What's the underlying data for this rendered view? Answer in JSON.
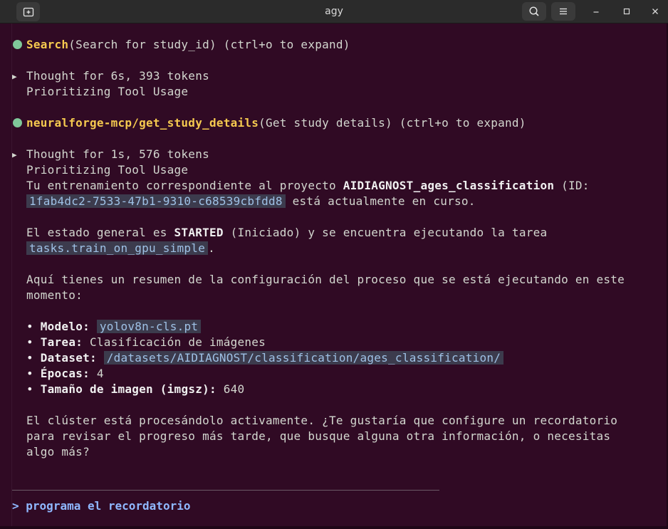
{
  "window": {
    "title": "agy",
    "icons": {
      "new_tab": "new-tab-icon",
      "search": "search-icon",
      "menu": "hamburger-menu-icon",
      "minimize": "minimize-icon",
      "maximize": "maximize-icon",
      "close": "close-icon"
    }
  },
  "colors": {
    "background": "#300a24",
    "tool_name": "#f5c94f",
    "status_dot": "#7fc89a",
    "code_text": "#9fc1e6",
    "prompt": "#8fb8ff"
  },
  "transcript": {
    "tool1": {
      "name": "Search",
      "args": "(Search for study_id) (ctrl+o to expand)"
    },
    "thought1": {
      "header": "Thought for 6s, 393 tokens",
      "subtitle": "Prioritizing Tool Usage"
    },
    "tool2": {
      "name": "neuralforge-mcp/get_study_details",
      "args": "(Get study details) (ctrl+o to expand)"
    },
    "thought2": {
      "header": "Thought for 1s, 576 tokens",
      "subtitle": "Prioritizing Tool Usage"
    },
    "response": {
      "p1_pre": "Tu entrenamiento correspondiente al proyecto ",
      "p1_project": "AIDIAGNOST_ages_classification",
      "p1_id_label": " (ID:",
      "p1_id": "1fab4dc2-7533-47b1-9310-c68539cbfdd8",
      "p1_post": " está actualmente en curso.",
      "p2_pre": "El estado general es ",
      "p2_status": "STARTED",
      "p2_mid": " (Iniciado) y se encuentra ejecutando la tarea",
      "p2_task": "tasks.train_on_gpu_simple",
      "p2_post": ".",
      "p3_line1": "Aquí tienes un resumen de la configuración del proceso que se está ejecutando en este",
      "p3_line2": "momento:",
      "bullet_char": "•",
      "bullets": {
        "model_label": "Modelo:",
        "model_value": "yolov8n-cls.pt",
        "task_label": "Tarea:",
        "task_value": "Clasificación de imágenes",
        "dataset_label": "Dataset:",
        "dataset_value": "/datasets/AIDIAGNOST/classification/ages_classification/",
        "epochs_label": "Épocas:",
        "epochs_value": "4",
        "imgsz_label": "Tamaño de imagen (imgsz):",
        "imgsz_value": "640"
      },
      "p4_line1": "El clúster está procesándolo activamente. ¿Te gustaría que configure un recordatorio",
      "p4_line2": "para revisar el progreso más tarde, que busque alguna otra información, o necesitas",
      "p4_line3": "algo más?"
    }
  },
  "prompt": {
    "caret": ">",
    "text": "programa el recordatorio"
  }
}
